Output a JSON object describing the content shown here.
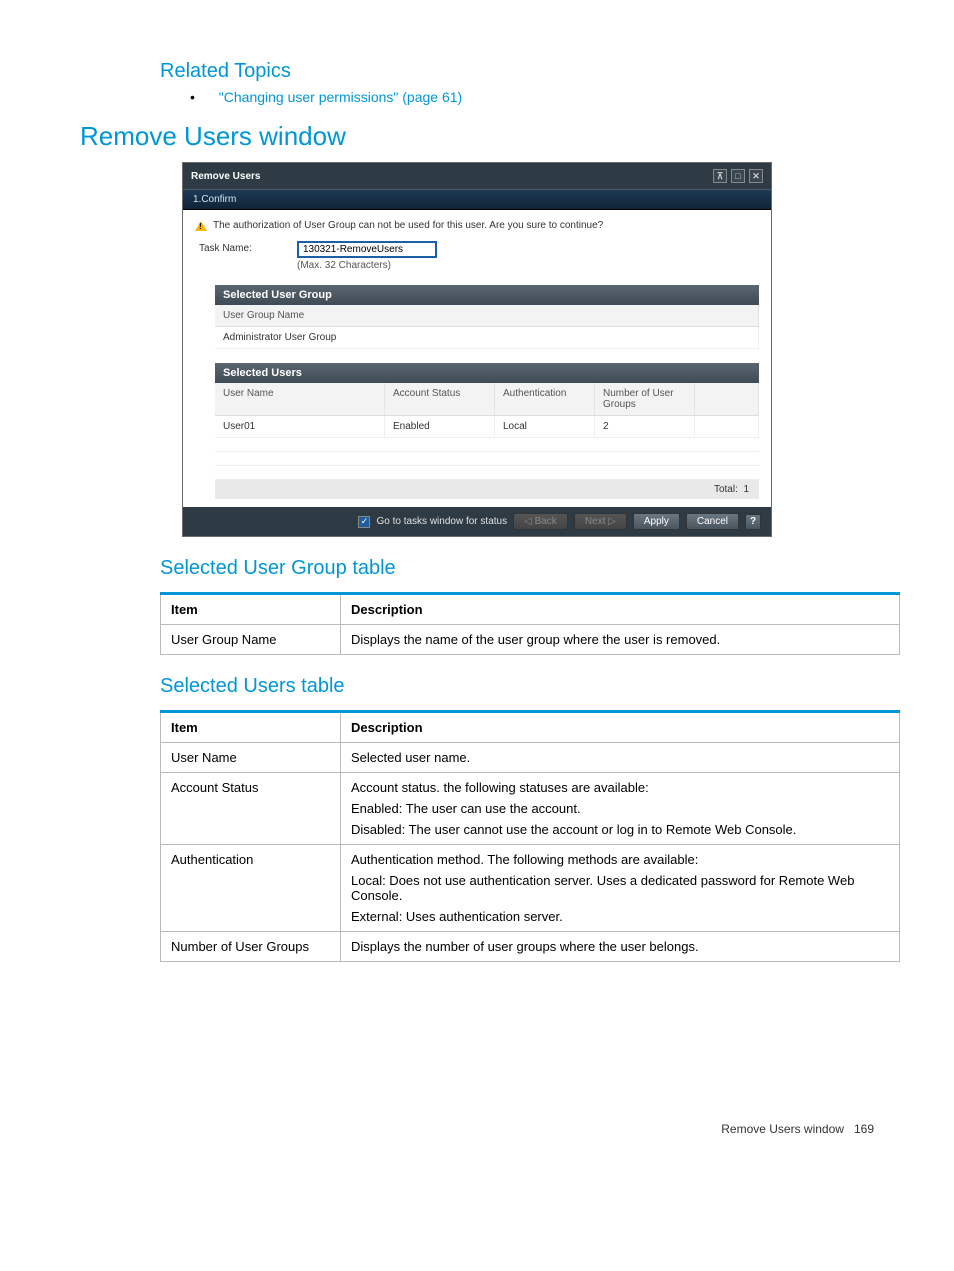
{
  "related_topics": {
    "heading": "Related Topics",
    "item": "\"Changing user permissions\" (page 61)"
  },
  "main_heading": "Remove Users window",
  "window": {
    "title": "Remove Users",
    "tab": "1.Confirm",
    "warning": "The authorization of User Group can not be used for this user. Are you sure to continue?",
    "task_label": "Task Name:",
    "task_value": "130321-RemoveUsers",
    "task_hint": "(Max. 32 Characters)",
    "group_header": "Selected User Group",
    "group_col": "User Group Name",
    "group_row": "Administrator User Group",
    "users_header": "Selected Users",
    "users_cols": {
      "c1": "User Name",
      "c2": "Account Status",
      "c3": "Authentication",
      "c4": "Number of User Groups"
    },
    "users_row": {
      "c1": "User01",
      "c2": "Enabled",
      "c3": "Local",
      "c4": "2"
    },
    "total_label": "Total:",
    "total_value": "1",
    "footer": {
      "check_label": "Go to tasks window for status",
      "back": "Back",
      "next": "Next",
      "apply": "Apply",
      "cancel": "Cancel"
    }
  },
  "tbl1": {
    "heading": "Selected User Group table",
    "h1": "Item",
    "h2": "Description",
    "r1c1": "User Group Name",
    "r1c2": "Displays the name of the user group where the user is removed."
  },
  "tbl2": {
    "heading": "Selected Users table",
    "h1": "Item",
    "h2": "Description",
    "rows": {
      "r1c1": "User Name",
      "r1c2": "Selected user name.",
      "r2c1": "Account Status",
      "r2c2a": "Account status. the following statuses are available:",
      "r2c2b": "Enabled: The user can use the account.",
      "r2c2c": "Disabled: The user cannot use the account or log in to Remote Web Console.",
      "r3c1": "Authentication",
      "r3c2a": "Authentication method. The following methods are available:",
      "r3c2b": "Local: Does not use authentication server. Uses a dedicated password for Remote Web Console.",
      "r3c2c": "External: Uses authentication server.",
      "r4c1": "Number of User Groups",
      "r4c2": "Displays the number of user groups where the user belongs."
    }
  },
  "footer": {
    "label": "Remove Users window",
    "page": "169"
  }
}
